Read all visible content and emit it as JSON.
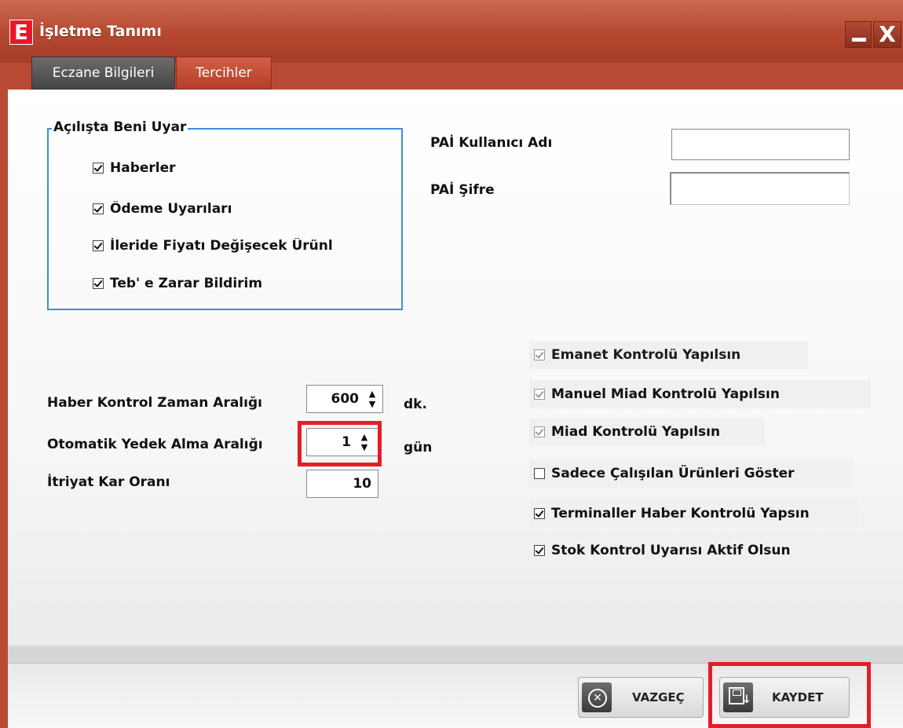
{
  "window": {
    "logo_letter": "E",
    "title": "İşletme Tanımı",
    "minimize_glyph": "_",
    "close_glyph": "X"
  },
  "tabs": [
    {
      "label": "Eczane Bilgileri",
      "active": false
    },
    {
      "label": "Tercihler",
      "active": true
    }
  ],
  "startup_warnings": {
    "title": "Açılışta Beni Uyar",
    "items": [
      {
        "label": "Haberler",
        "checked": true
      },
      {
        "label": "Ödeme Uyarıları",
        "checked": true
      },
      {
        "label": "İleride Fiyatı Değişecek Ürünl",
        "checked": true
      },
      {
        "label": "Teb' e Zarar Bildirim",
        "checked": true
      }
    ]
  },
  "pai": {
    "username_label": "PAİ Kullanıcı Adı",
    "username_value": "",
    "password_label": "PAİ Şifre",
    "password_value": ""
  },
  "settings": {
    "news_interval_label": "Haber Kontrol Zaman Aralığı",
    "news_interval_value": "600",
    "news_interval_unit": "dk.",
    "backup_interval_label": "Otomatik Yedek Alma Aralığı",
    "backup_interval_value": "1",
    "backup_interval_unit": "gün",
    "perfume_margin_label": "İtriyat Kar Oranı",
    "perfume_margin_value": "10"
  },
  "options": [
    {
      "label": "Emanet Kontrolü Yapılsın",
      "checked": true,
      "enabled": false
    },
    {
      "label": "Manuel Miad Kontrolü Yapılsın",
      "checked": true,
      "enabled": false
    },
    {
      "label": "Miad Kontrolü Yapılsın",
      "checked": true,
      "enabled": false
    },
    {
      "label": "Sadece Çalışılan Ürünleri Göster",
      "checked": false,
      "enabled": true
    },
    {
      "label": "Terminaller Haber Kontrolü Yapsın",
      "checked": true,
      "enabled": true
    },
    {
      "label": "Stok Kontrol Uyarısı Aktif Olsun",
      "checked": true,
      "enabled": true
    }
  ],
  "buttons": {
    "cancel_label": "VAZGEÇ",
    "save_label": "KAYDET"
  },
  "colors": {
    "title_bar": "#b84a33",
    "group_border": "#3d8ed8",
    "highlight": "#e31e26"
  }
}
